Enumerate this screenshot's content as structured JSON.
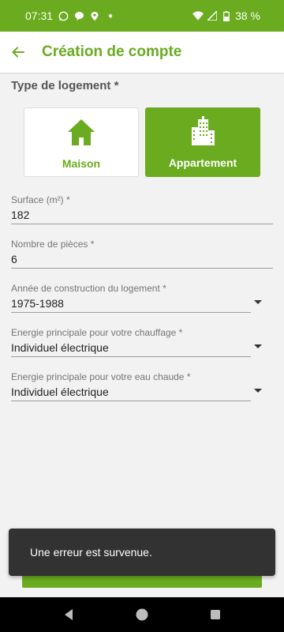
{
  "status_bar": {
    "time": "07:31",
    "battery": "38 %",
    "icons": [
      "whatsapp-icon",
      "chat-bubble-icon",
      "location-icon",
      "dot-icon",
      "wifi-icon",
      "signal-icon",
      "battery-icon"
    ]
  },
  "app_bar": {
    "title": "Création de compte",
    "back_icon": "arrow-left-icon"
  },
  "form": {
    "housing_type_label": "Type de logement *",
    "housing_types": [
      {
        "label": "Maison",
        "icon": "house-icon",
        "selected": false
      },
      {
        "label": "Appartement",
        "icon": "building-icon",
        "selected": true
      }
    ],
    "surface": {
      "label": "Surface (m²) *",
      "value": "182"
    },
    "rooms": {
      "label": "Nombre de pièces *",
      "value": "6"
    },
    "construction_year": {
      "label": "Année de construction du logement *",
      "value": "1975-1988"
    },
    "heating_energy": {
      "label": "Energie principale pour votre chauffage *",
      "value": "Individuel électrique"
    },
    "hot_water_energy": {
      "label": "Energie principale pour votre eau chaude *",
      "value": "Individuel électrique"
    }
  },
  "snackbar": {
    "message": "Une erreur est survenue."
  },
  "colors": {
    "accent": "#6aab1f",
    "snackbar": "#323232"
  }
}
